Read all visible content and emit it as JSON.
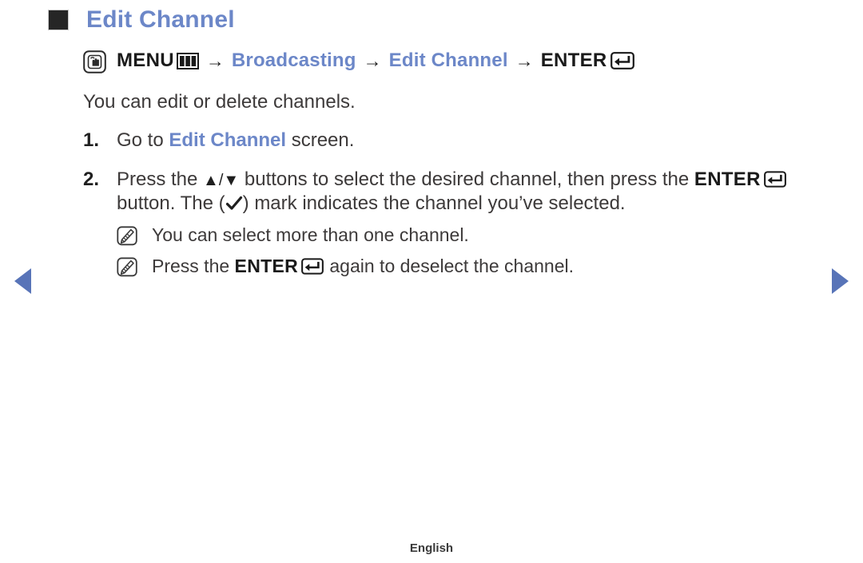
{
  "page": {
    "title": "Edit Channel",
    "title_bullet_color": "#262626",
    "accent_blue": "#6c87c8",
    "nav_arrow_color": "#5874b8",
    "text_color": "#3d3a3a",
    "background": "#ffffff"
  },
  "menu_path": {
    "press_icon": "remote-press-icon",
    "menu_label": "MENU",
    "menu_icon": "menu-bars-icon",
    "arrow": "→",
    "broadcasting_label": "Broadcasting",
    "edit_channel_label": "Edit Channel",
    "enter_label": "ENTER",
    "enter_icon": "enter-key-icon"
  },
  "intro": {
    "text": "You can edit or delete channels."
  },
  "steps": [
    {
      "number": "1.",
      "parts": [
        {
          "text": "Go to ",
          "style": "normal"
        },
        {
          "text": "Edit Channel",
          "style": "blue-bold"
        },
        {
          "text": " screen.",
          "style": "normal"
        }
      ],
      "plain": "Go to Edit Channel screen."
    },
    {
      "number": "2.",
      "parts": [
        {
          "text": "Press the ",
          "style": "normal"
        },
        {
          "text": "▲/▼",
          "style": "triangles"
        },
        {
          "text": " buttons to select the desired channel, then press the ",
          "style": "normal"
        },
        {
          "text": "ENTER",
          "style": "dark-bold"
        },
        {
          "text": "enter-key-icon",
          "style": "icon"
        },
        {
          "text": " button. The (",
          "style": "normal"
        },
        {
          "text": "check-mark-icon",
          "style": "icon"
        },
        {
          "text": ") mark indicates the channel you’ve selected.",
          "style": "normal"
        }
      ],
      "plain": "Press the ▲/▼ buttons to select the desired channel, then press the ENTER button. The (✓) mark indicates the channel you’ve selected."
    }
  ],
  "step2_line1_a": "Press the ",
  "step2_triangles": "▲",
  "step2_slash": "/",
  "step2_triangle_down": "▼",
  "step2_line1_b": " buttons to select the desired channel, then press the",
  "step2_enter": "ENTER",
  "step2_line2_a": " button. The (",
  "step2_line2_b": ") mark indicates the channel you’ve selected.",
  "notes": [
    {
      "icon": "note-pencil-icon",
      "parts": [
        {
          "text": "You can select more than one channel.",
          "style": "normal"
        }
      ],
      "plain": "You can select more than one channel.",
      "pre": "You can select more than one channel.",
      "bold": "",
      "post": ""
    },
    {
      "icon": "note-pencil-icon",
      "parts": [
        {
          "text": "Press the ",
          "style": "normal"
        },
        {
          "text": "ENTER",
          "style": "dark-bold"
        },
        {
          "text": "enter-key-icon",
          "style": "icon"
        },
        {
          "text": " again to deselect the channel.",
          "style": "normal"
        }
      ],
      "plain": "Press the ENTER again to deselect the channel.",
      "pre": "Press the ",
      "bold": "ENTER",
      "post": " again to deselect the channel."
    }
  ],
  "navigation": {
    "previous_label": "previous-page-arrow",
    "next_label": "next-page-arrow"
  },
  "footer": {
    "language": "English"
  }
}
